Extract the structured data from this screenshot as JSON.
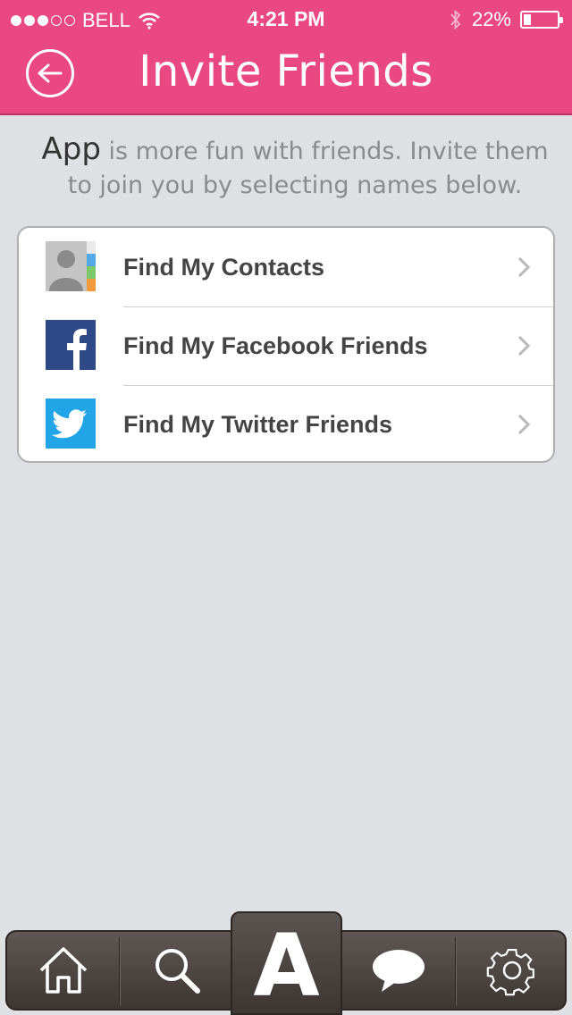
{
  "status_bar": {
    "carrier": "BELL",
    "time": "4:21 PM",
    "battery": "22%",
    "battery_level": 0.22,
    "icons": [
      "signal-dots-icon",
      "wifi-icon",
      "bluetooth-icon",
      "battery-icon"
    ]
  },
  "header": {
    "title": "Invite Friends",
    "back_icon": "back-arrow-icon",
    "color": "#e94880"
  },
  "intro": {
    "app_name": "App",
    "text": " is more fun with friends. Invite them to join you by selecting names below."
  },
  "options": [
    {
      "label": "Find My Contacts",
      "icon": "contacts-icon"
    },
    {
      "label": "Find My Facebook Friends",
      "icon": "facebook-icon"
    },
    {
      "label": "Find My Twitter Friends",
      "icon": "twitter-icon"
    }
  ],
  "tabbar": {
    "tabs": [
      "home-icon",
      "search-icon",
      "app-logo",
      "chat-icon",
      "settings-icon"
    ],
    "center_label": "A"
  }
}
